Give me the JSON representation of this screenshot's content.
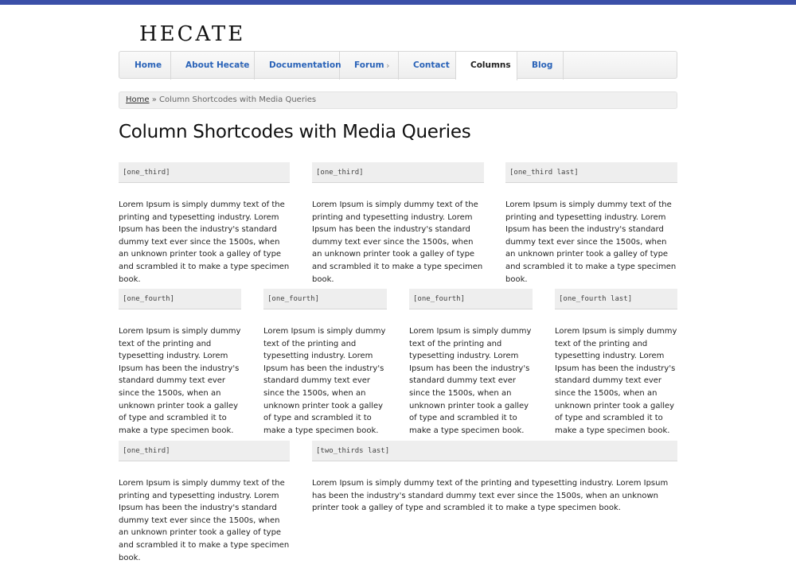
{
  "site": {
    "logo": "HECATE",
    "accent_color": "#3b4fa8",
    "link_color": "#2a63b8"
  },
  "nav": {
    "items": [
      {
        "label": "Home"
      },
      {
        "label": "About Hecate",
        "submenu_icon": "chevron-right-icon"
      },
      {
        "label": "Documentation"
      },
      {
        "label": "Forum",
        "submenu_icon": "chevron-right-icon"
      },
      {
        "label": "Contact"
      },
      {
        "label": "Columns",
        "active": true
      },
      {
        "label": "Blog"
      }
    ]
  },
  "breadcrumb": {
    "home": "Home",
    "separator": "»",
    "current": "Column Shortcodes with Media Queries"
  },
  "page": {
    "title": "Column Shortcodes with Media Queries"
  },
  "lorem": "Lorem Ipsum is simply dummy text of the printing and typesetting industry. Lorem Ipsum has been the industry's standard dummy text ever since the 1500s, when an unknown printer took a galley of type and scrambled it to make a type specimen book.",
  "rows": [
    {
      "columns": [
        {
          "shortcode": "[one_third]"
        },
        {
          "shortcode": "[one_third]"
        },
        {
          "shortcode": "[one_third last]"
        }
      ]
    },
    {
      "columns": [
        {
          "shortcode": "[one_fourth]"
        },
        {
          "shortcode": "[one_fourth]"
        },
        {
          "shortcode": "[one_fourth]"
        },
        {
          "shortcode": "[one_fourth last]"
        }
      ]
    },
    {
      "columns": [
        {
          "shortcode": "[one_third]"
        },
        {
          "shortcode": "[two_thirds last]"
        }
      ]
    }
  ]
}
